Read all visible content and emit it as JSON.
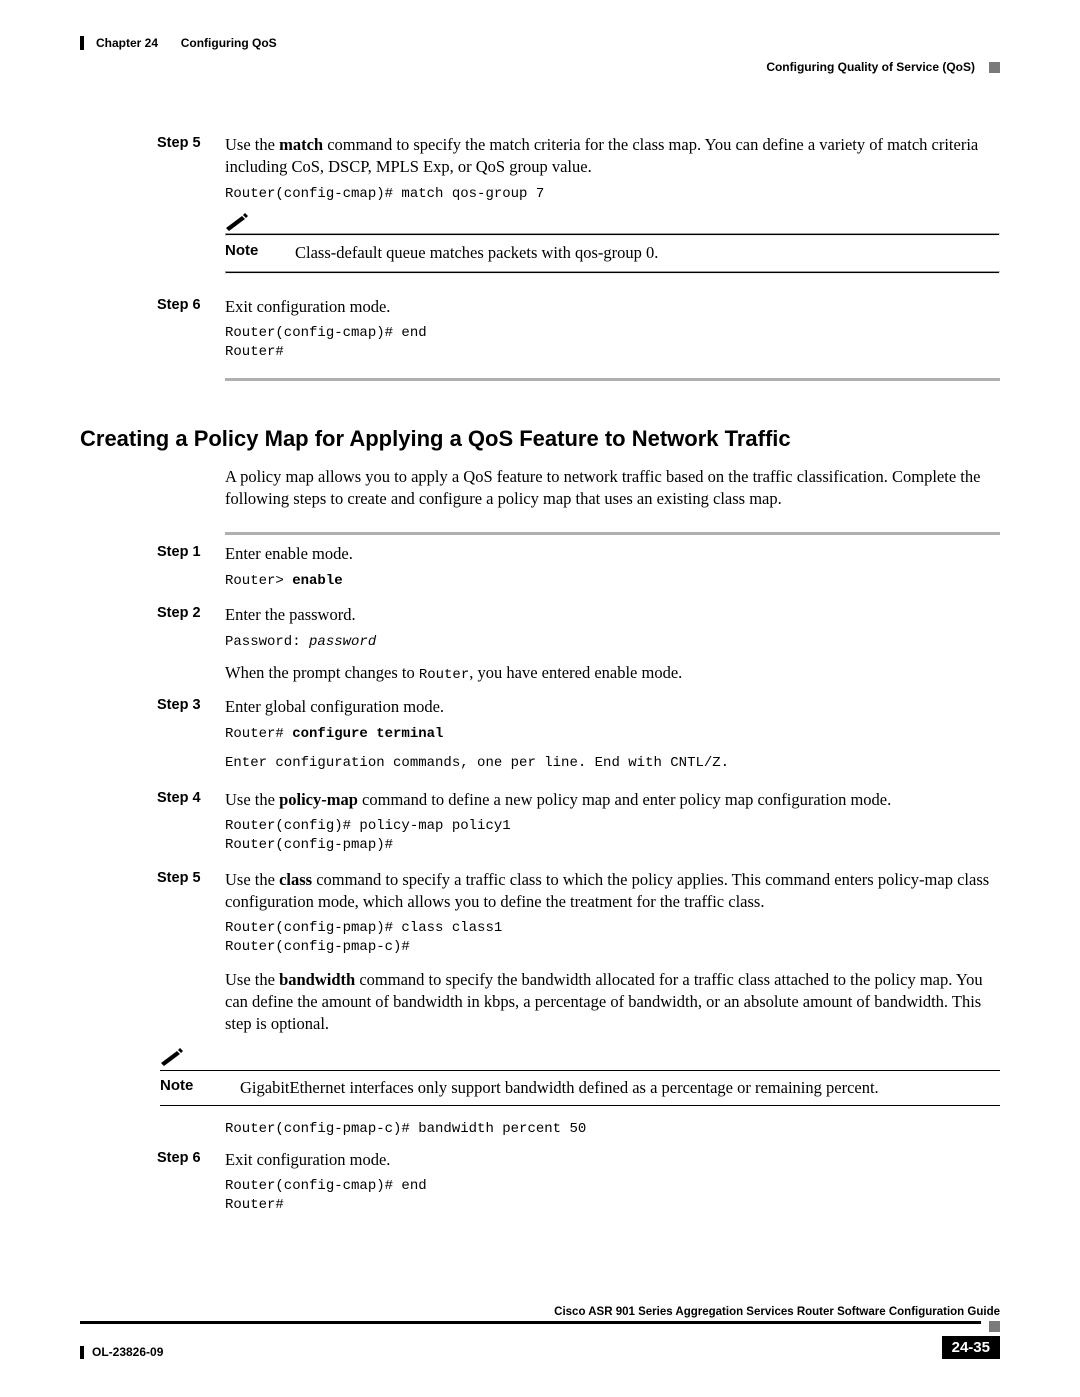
{
  "header": {
    "chapter_label": "Chapter 24",
    "chapter_title": "Configuring QoS",
    "section_right": "Configuring Quality of Service (QoS)"
  },
  "top_steps": {
    "step5": {
      "label": "Step 5",
      "desc_pre": "Use the ",
      "bold1": "match",
      "desc_post": " command to specify the match criteria for the class map. You can define a variety of match criteria including CoS, DSCP, MPLS Exp, or QoS group value.",
      "code": "Router(config-cmap)# match qos-group 7",
      "note_label": "Note",
      "note_text": "Class-default queue matches packets with qos-group 0."
    },
    "step6": {
      "label": "Step 6",
      "desc": "Exit configuration mode.",
      "code": "Router(config-cmap)# end\nRouter#"
    }
  },
  "section_heading": "Creating a Policy Map for Applying a QoS Feature to Network Traffic",
  "intro": "A policy map allows you to apply a QoS feature to network traffic based on the traffic classification. Complete the following steps to create and configure a policy map that uses an existing class map.",
  "steps2": {
    "step1": {
      "label": "Step 1",
      "desc": "Enter enable mode.",
      "code_pre": "Router> ",
      "code_bold": "enable"
    },
    "step2": {
      "label": "Step 2",
      "desc": "Enter the password.",
      "code_pre": "Password: ",
      "code_italic": "password",
      "after_pre": "When the prompt changes to ",
      "after_mono": "Router",
      "after_post": ",  you have entered enable mode."
    },
    "step3": {
      "label": "Step 3",
      "desc": "Enter global configuration mode.",
      "code_pre": "Router# ",
      "code_bold": "configure terminal",
      "code2": "Enter configuration commands, one per line. End with CNTL/Z."
    },
    "step4": {
      "label": "Step 4",
      "desc_pre": "Use the ",
      "bold1": "policy-map",
      "desc_post": " command to define a new policy map and enter policy map configuration mode.",
      "code": "Router(config)# policy-map policy1\nRouter(config-pmap)#"
    },
    "step5": {
      "label": "Step 5",
      "desc_pre": "Use the ",
      "bold1": "class",
      "desc_post": " command to specify a traffic class to which the policy applies. This command enters policy-map class configuration mode, which allows you to define the treatment for the traffic class.",
      "code": "Router(config-pmap)# class class1\nRouter(config-pmap-c)#",
      "bw_pre": "Use the ",
      "bw_bold": "bandwidth",
      "bw_post": " command to specify the bandwidth allocated for a traffic class attached to the policy map. You can define the amount of bandwidth in kbps, a percentage of bandwidth, or an absolute amount of bandwidth. This step is optional."
    },
    "note2": {
      "label": "Note",
      "text": "GigabitEthernet interfaces only support bandwidth defined as a percentage or remaining percent.",
      "code": "Router(config-pmap-c)# bandwidth percent 50"
    },
    "step6": {
      "label": "Step 6",
      "desc": "Exit configuration mode.",
      "code": "Router(config-cmap)# end\nRouter#"
    }
  },
  "footer": {
    "doc_title": "Cisco ASR 901 Series Aggregation Services Router Software Configuration Guide",
    "doc_id": "OL-23826-09",
    "page_num": "24-35"
  }
}
